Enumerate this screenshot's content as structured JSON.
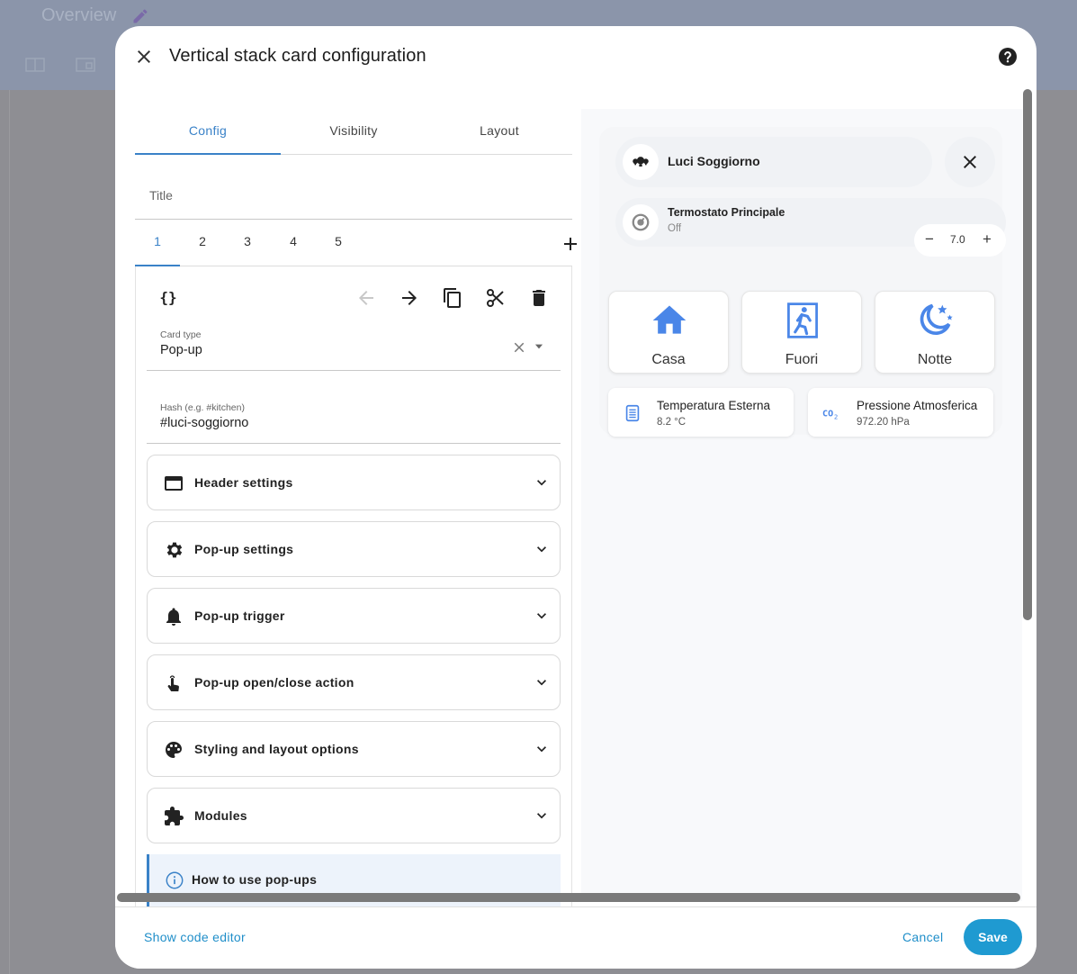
{
  "background": {
    "title": "Overview"
  },
  "dialog": {
    "title": "Vertical stack card configuration",
    "tabs": [
      {
        "label": "Config"
      },
      {
        "label": "Visibility"
      },
      {
        "label": "Layout"
      }
    ],
    "title_field_label": "Title",
    "card_tabs": [
      "1",
      "2",
      "3",
      "4",
      "5"
    ],
    "card_type": {
      "label": "Card type",
      "value": "Pop-up"
    },
    "hash": {
      "label": "Hash (e.g. #kitchen)",
      "value": "#luci-soggiorno"
    },
    "accordions": [
      {
        "label": "Header settings",
        "icon": "header-icon"
      },
      {
        "label": "Pop-up settings",
        "icon": "gear-icon"
      },
      {
        "label": "Pop-up trigger",
        "icon": "bell-icon"
      },
      {
        "label": "Pop-up open/close action",
        "icon": "touch-icon"
      },
      {
        "label": "Styling and layout options",
        "icon": "palette-icon"
      },
      {
        "label": "Modules",
        "icon": "puzzle-icon"
      }
    ],
    "info_label": "How to use pop-ups"
  },
  "preview": {
    "header_name": "Luci Soggiorno",
    "thermostat": {
      "name": "Termostato Principale",
      "state": "Off",
      "value": "7.0"
    },
    "buttons": [
      {
        "label": "Casa"
      },
      {
        "label": "Fuori"
      },
      {
        "label": "Notte"
      }
    ],
    "sensors": [
      {
        "name": "Temperatura Esterna",
        "value": "8.2 °C"
      },
      {
        "name": "Pressione Atmosferica",
        "value": "972.20 hPa"
      }
    ]
  },
  "footer": {
    "code_editor": "Show code editor",
    "cancel": "Cancel",
    "save": "Save"
  },
  "colors": {
    "accent": "#3a82c8",
    "link": "#1f8ec9",
    "save": "#1f9ad1",
    "icon_blue": "#4a86e8"
  }
}
